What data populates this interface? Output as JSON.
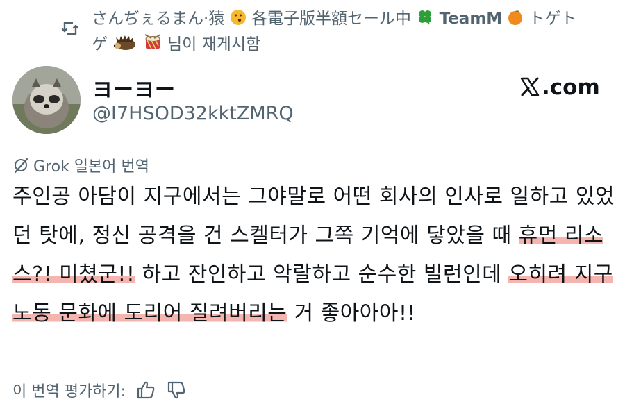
{
  "repost": {
    "text": "さんぢぇるまん·猿",
    "text2": "各電子版半額セール中",
    "text3": "TeamM",
    "text4": "トゲトゲ",
    "text5": "님이 재게시함"
  },
  "author": {
    "name": "ヨーヨー",
    "handle": "@I7HSOD32kktZMRQ"
  },
  "source": {
    "label": ".com"
  },
  "translation": {
    "label": "Grok 일본어 번역"
  },
  "post": {
    "part1": "주인공 아담이 지구에서는 그야말로 어떤 회사의 인사로 일하고 있었던 탓에, 정신 공격을 건 스켈터가 그쪽 기억에 닿았을 때 ",
    "hl1": "휴먼 리소스?! 미쳤군!!",
    "part2": " 하고 잔인하고 악랄하고 순수한 빌런인데 ",
    "hl2": "오히려 지구 노동 문화에 도리어 질려버리는",
    "part3": " 거 좋아아아!!"
  },
  "rating": {
    "label": "이 번역 평가하기:"
  },
  "icons": {
    "repost": "repost-icon",
    "grok": "grok-icon",
    "like": "thumbs-up-icon",
    "dislike": "thumbs-down-icon",
    "x": "x-logo-icon"
  }
}
